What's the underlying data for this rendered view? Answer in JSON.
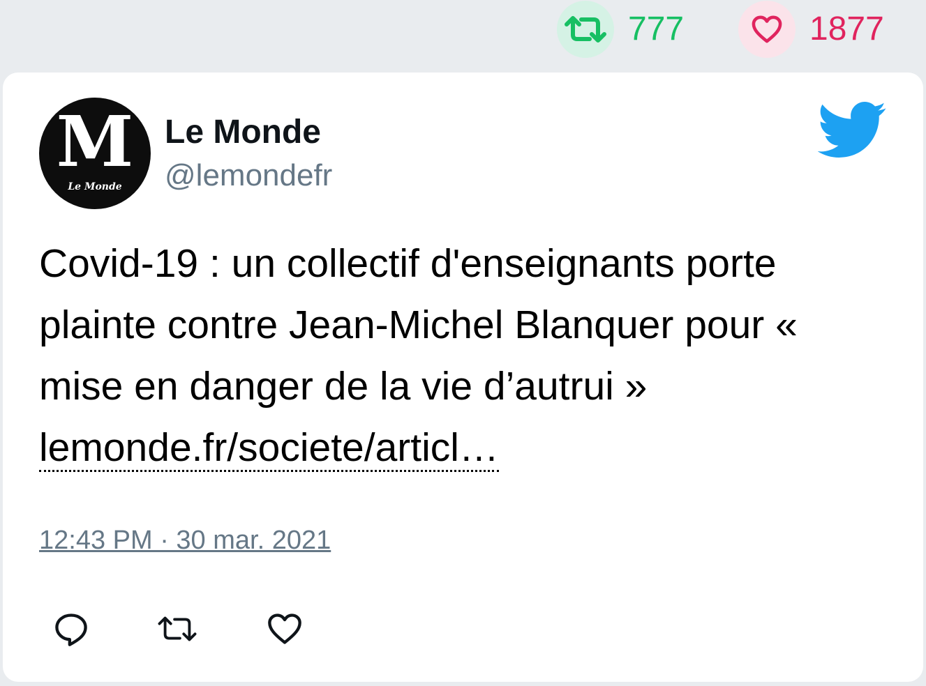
{
  "stats": {
    "retweet_icon": "retweet-icon",
    "retweet_count": "777",
    "retweet_color": "#17bf63",
    "like_icon": "heart-icon",
    "like_count": "1877",
    "like_color": "#e0245e"
  },
  "tweet": {
    "avatar_logo": "Le Monde logo",
    "author_name": "Le Monde",
    "author_handle": "@lemondefr",
    "brand_icon": "twitter-bird-icon",
    "brand_color": "#1da1f2",
    "text": "Covid-19 : un collectif d'enseignants porte plainte contre Jean-Michel Blanquer pour « mise en danger de la vie d’autrui » ",
    "link": "lemonde.fr/societe/articl…",
    "timestamp": "12:43 PM · 30 mar. 2021",
    "actions": [
      "reply-icon",
      "retweet-icon",
      "heart-icon"
    ]
  }
}
